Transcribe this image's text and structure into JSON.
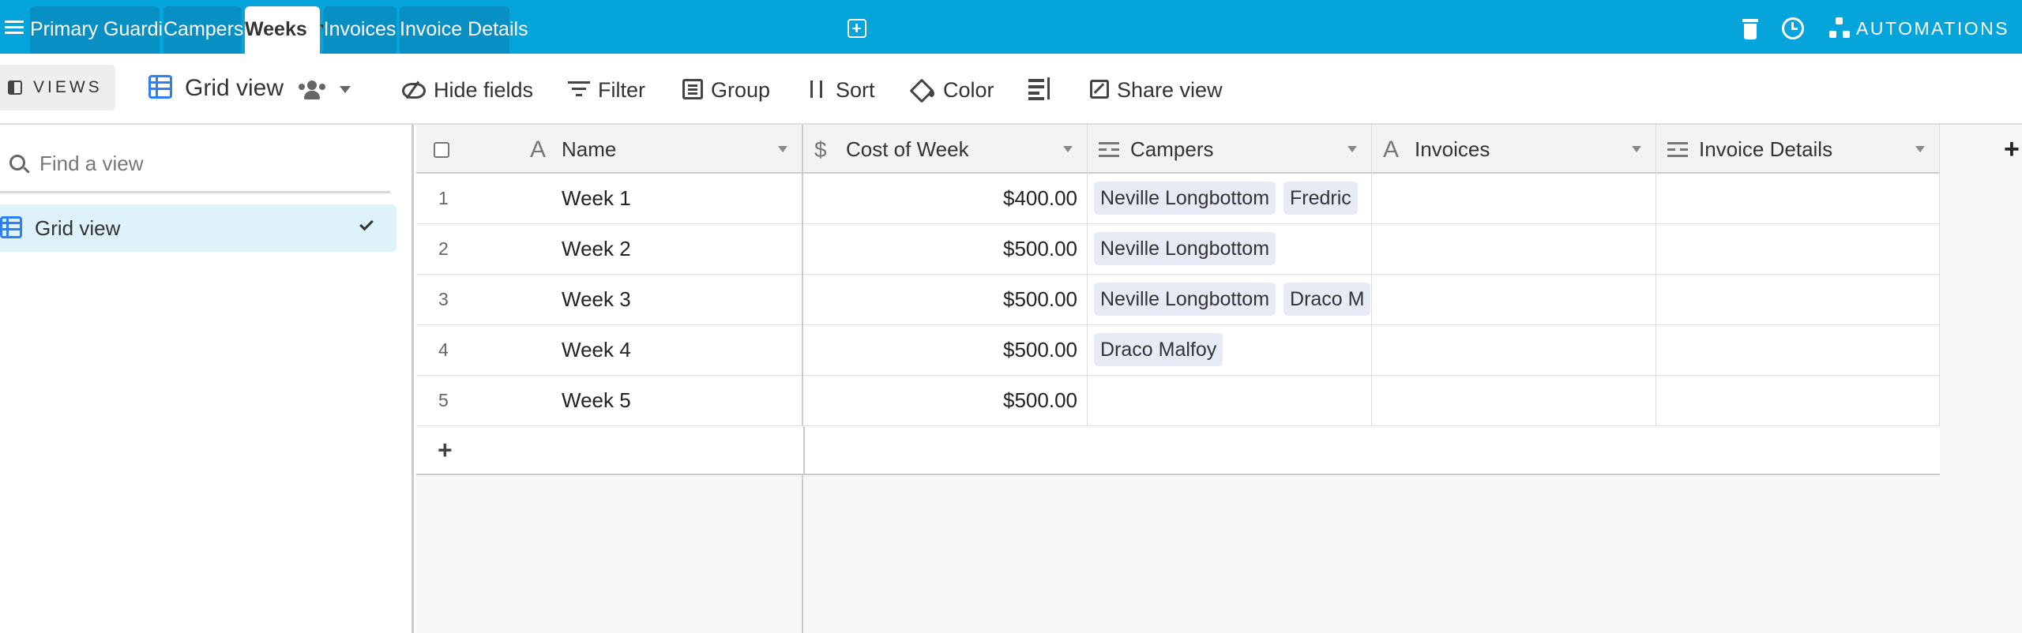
{
  "tabs": [
    {
      "label": "Primary Guardians",
      "active": false
    },
    {
      "label": "Campers",
      "active": false
    },
    {
      "label": "Weeks",
      "active": true
    },
    {
      "label": "Invoices",
      "active": false
    },
    {
      "label": "Invoice Details",
      "active": false
    }
  ],
  "header_right": {
    "automations_label": "AUTOMATIONS"
  },
  "viewbar": {
    "views_label": "VIEWS",
    "view_name": "Grid view",
    "tools": {
      "hide_fields": "Hide fields",
      "filter": "Filter",
      "group": "Group",
      "sort": "Sort",
      "color": "Color",
      "share_view": "Share view"
    }
  },
  "sidebar": {
    "search_placeholder": "Find a view",
    "views": [
      {
        "name": "Grid view",
        "selected": true
      }
    ]
  },
  "table": {
    "columns": [
      "Name",
      "Cost of Week",
      "Campers",
      "Invoices",
      "Invoice Details"
    ],
    "rows": [
      {
        "num": "1",
        "name": "Week 1",
        "cost": "$400.00",
        "campers": [
          "Neville Longbottom",
          "Fredric"
        ],
        "invoices": "",
        "invoice_details": ""
      },
      {
        "num": "2",
        "name": "Week 2",
        "cost": "$500.00",
        "campers": [
          "Neville Longbottom"
        ],
        "invoices": "",
        "invoice_details": ""
      },
      {
        "num": "3",
        "name": "Week 3",
        "cost": "$500.00",
        "campers": [
          "Neville Longbottom",
          "Draco M"
        ],
        "invoices": "",
        "invoice_details": ""
      },
      {
        "num": "4",
        "name": "Week 4",
        "cost": "$500.00",
        "campers": [
          "Draco Malfoy"
        ],
        "invoices": "",
        "invoice_details": ""
      },
      {
        "num": "5",
        "name": "Week 5",
        "cost": "$500.00",
        "campers": [],
        "invoices": "",
        "invoice_details": ""
      }
    ],
    "add_row_label": "+",
    "add_field_label": "+"
  },
  "colors": {
    "topbar": "#05a4db",
    "tab_inactive": "#0890c4",
    "accent_blue": "#2d7ff9",
    "selected_view_bg": "#def2fa",
    "pill_bg": "#e6ebf6"
  },
  "icons": [
    "menu-icon",
    "add-tab-icon",
    "trash-icon",
    "history-icon",
    "automations-icon",
    "panel-icon",
    "grid-view-icon",
    "collaborators-icon",
    "hide-fields-icon",
    "filter-icon",
    "group-icon",
    "sort-icon",
    "color-icon",
    "row-height-icon",
    "share-view-icon",
    "search-icon",
    "check-icon",
    "text-field-icon",
    "currency-field-icon",
    "link-field-icon"
  ]
}
